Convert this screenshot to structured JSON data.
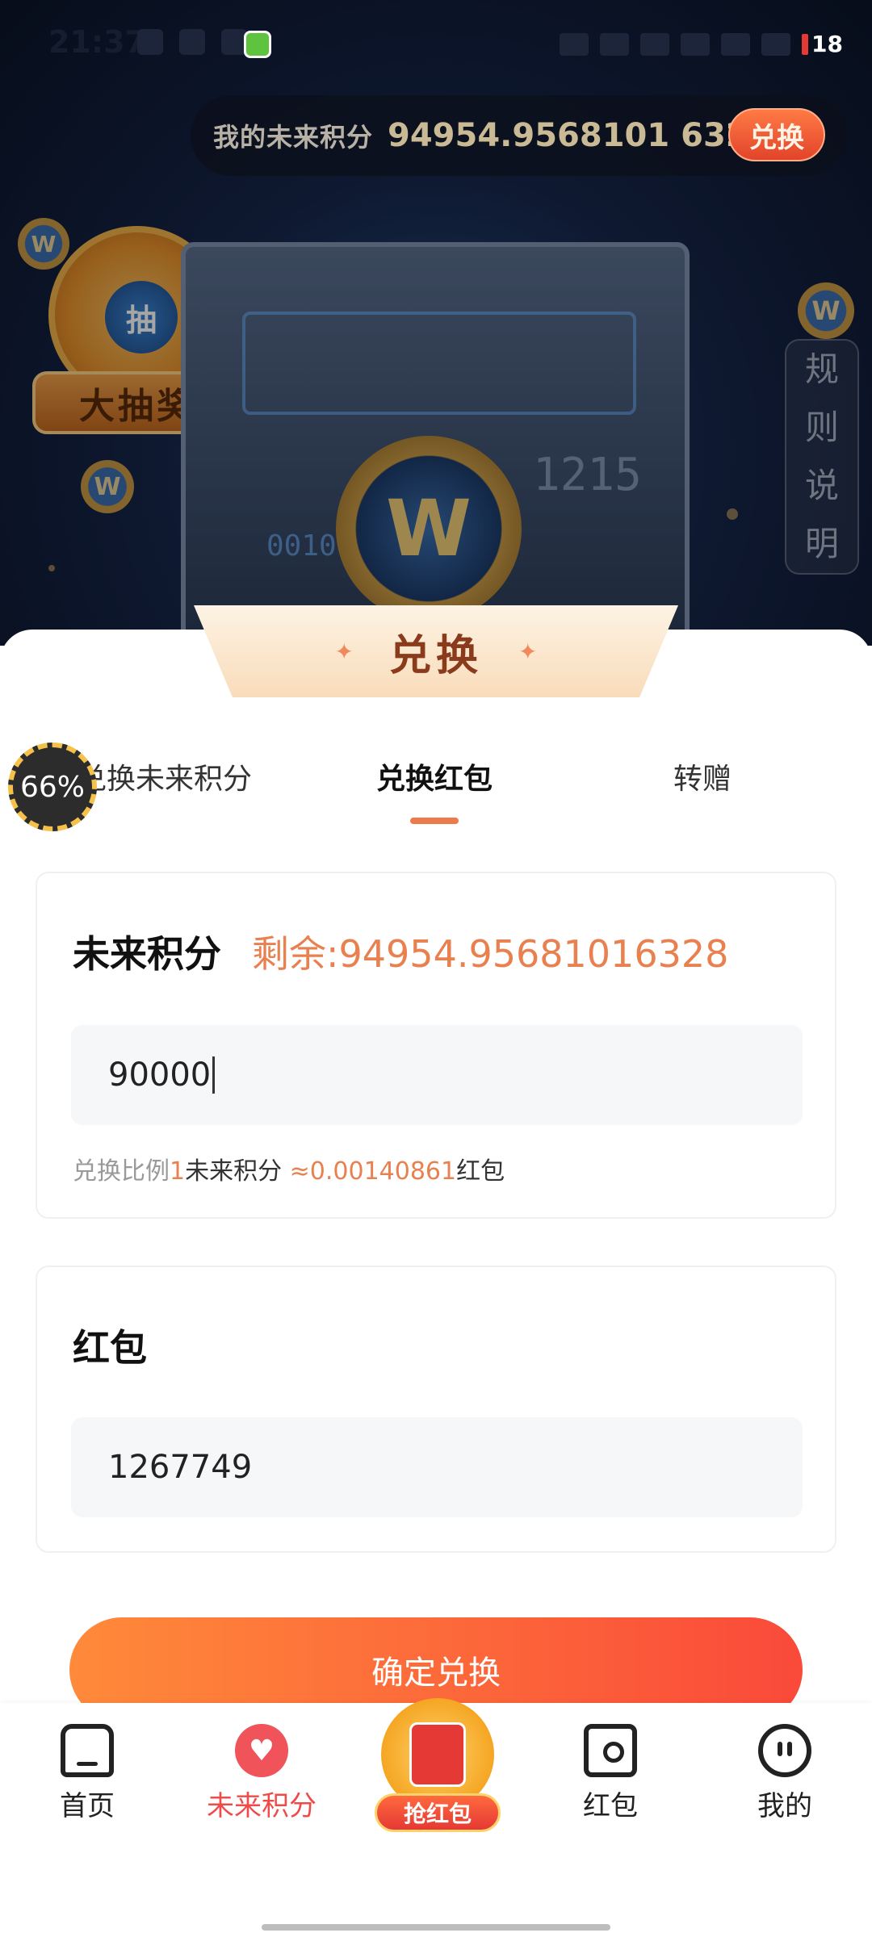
{
  "status_bar": {
    "time": "21:37",
    "battery": "18"
  },
  "header": {
    "points_label": "我的未来积分",
    "points_value": "94954.9568101 6328",
    "exchange_btn": "兑换"
  },
  "hero": {
    "lottery_label": "大抽奖",
    "lottery_center": "抽",
    "coin_letter": "W",
    "vault_number": "1215",
    "vault_digits": "001000",
    "rules_chars": [
      "规",
      "则",
      "说",
      "明"
    ]
  },
  "card": {
    "title": "兑换",
    "tabs": [
      "兑换未来积分",
      "兑换红包",
      "转赠"
    ],
    "active_tab": "兑换红包",
    "progress_badge": "66%"
  },
  "form": {
    "points_title": "未来积分",
    "remain_label": "剩余:",
    "remain_value": "94954.95681016328",
    "amount_value": "90000",
    "ratio_prefix": "兑换比例",
    "ratio_one": "1",
    "ratio_unit": "未来积分",
    "ratio_value": "≈0.00140861",
    "ratio_suffix": "红包",
    "redpacket_title": "红包",
    "redpacket_value": "1267749",
    "confirm_label": "确定兑换"
  },
  "nav": {
    "home": "首页",
    "points": "未来积分",
    "grab": "抢红包",
    "redpacket": "红包",
    "mine": "我的"
  },
  "colors": {
    "accent": "#e8804f",
    "nav_active": "#ef4b49",
    "button_start": "#ff8a3a",
    "button_end": "#fa4a3a"
  },
  "icons": [
    "home-icon",
    "heart-icon",
    "red-envelope-icon",
    "envelope-icon",
    "face-icon"
  ]
}
